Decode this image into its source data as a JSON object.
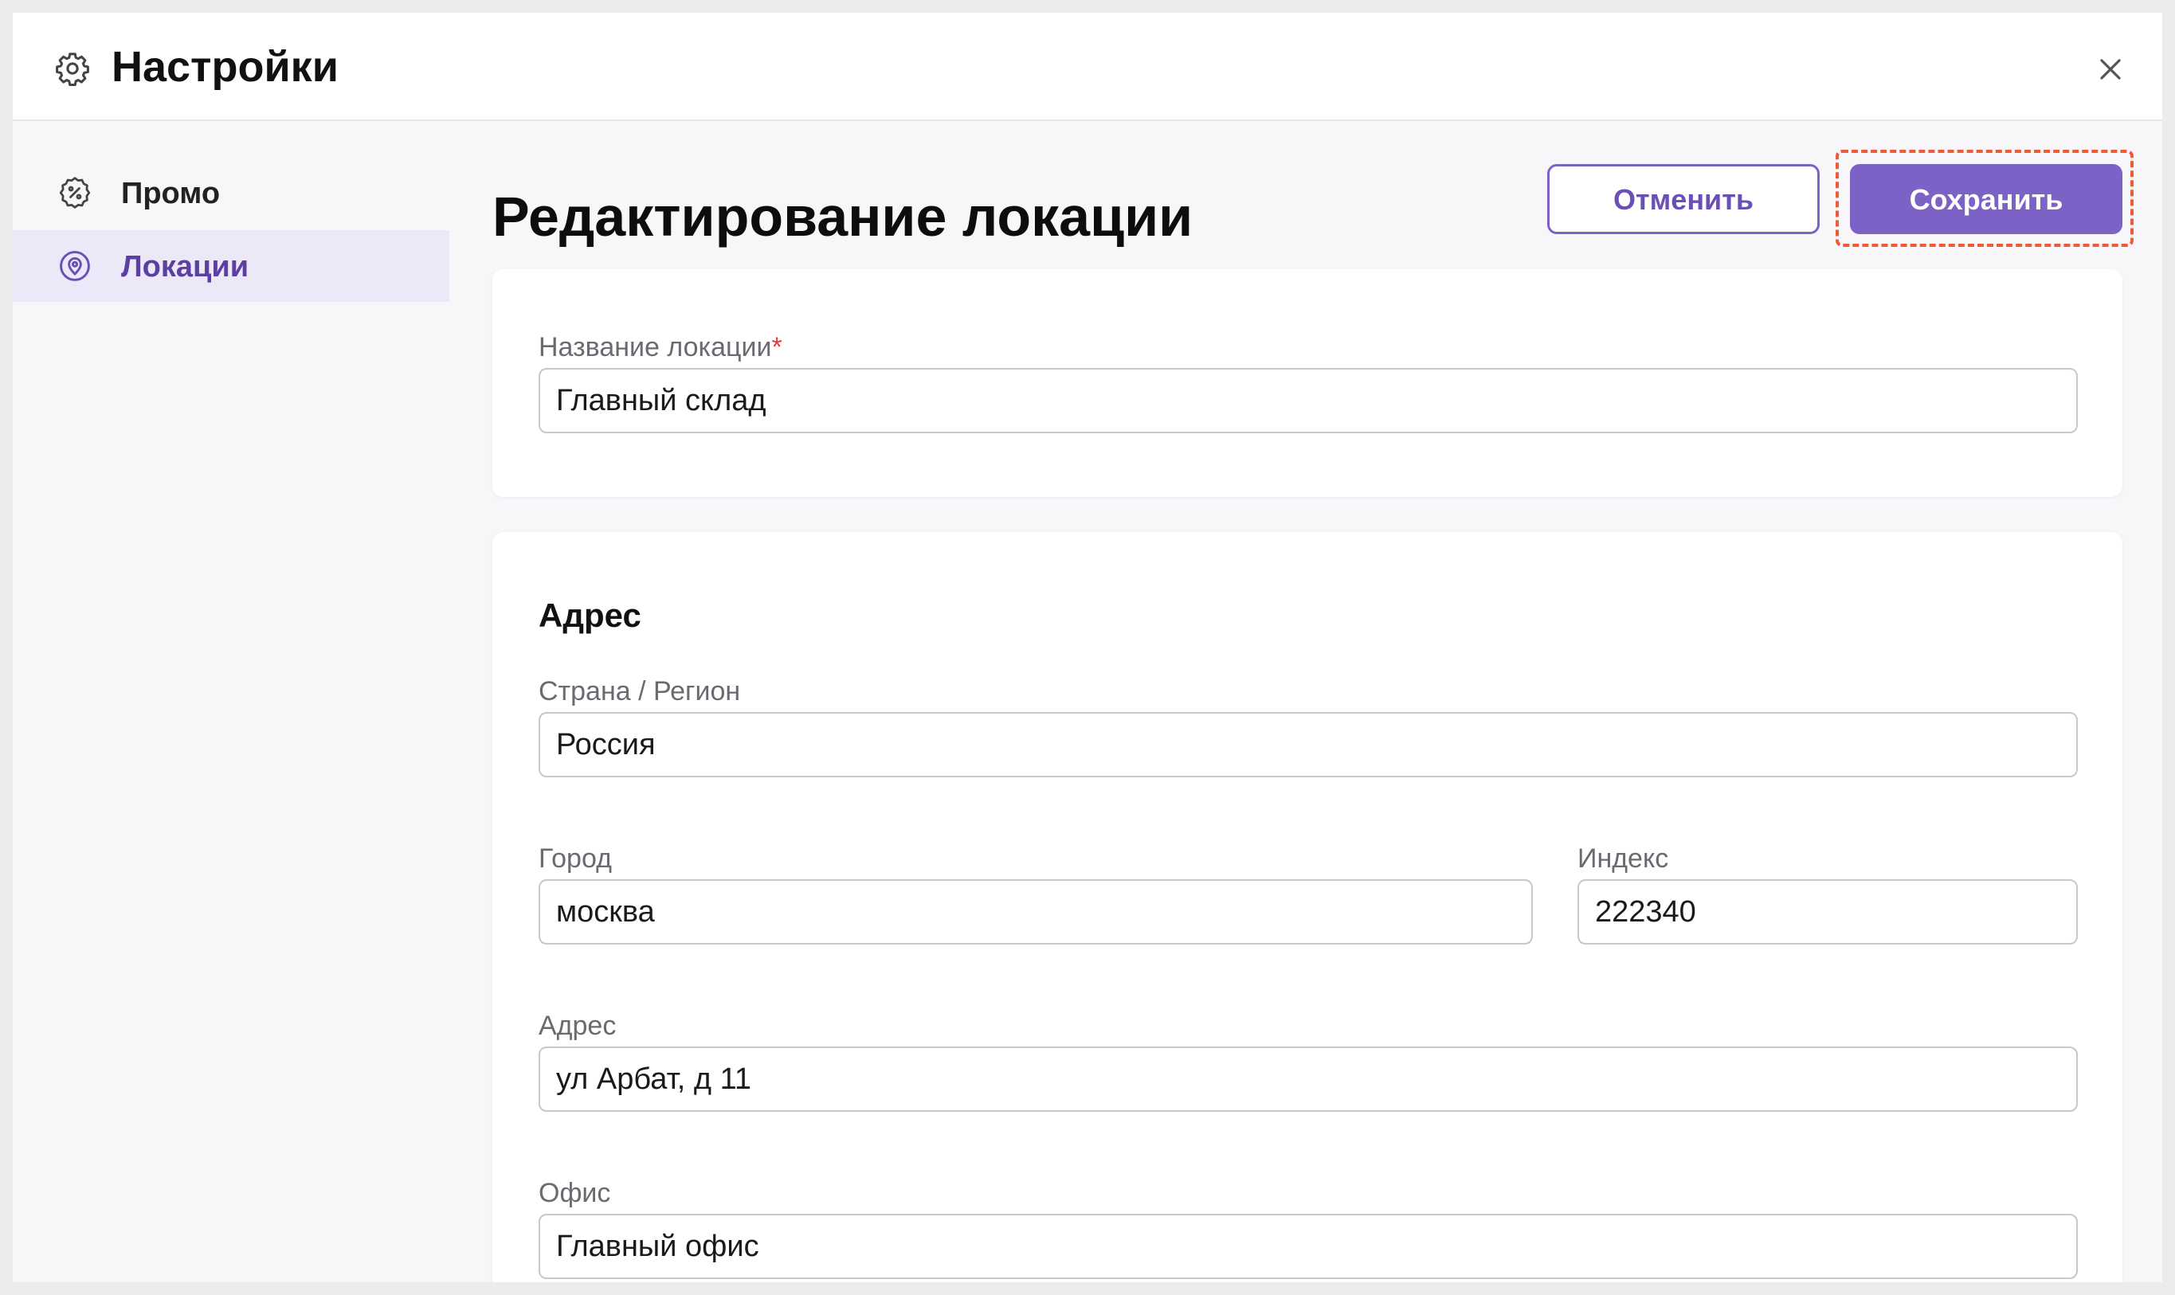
{
  "header": {
    "title": "Настройки",
    "gear_icon": "gear-icon",
    "close_icon": "close-icon"
  },
  "sidebar": {
    "items": [
      {
        "label": "Промо",
        "icon": "percent-badge-icon",
        "active": false
      },
      {
        "label": "Локации",
        "icon": "location-pin-icon",
        "active": true
      }
    ]
  },
  "main": {
    "title": "Редактирование локации",
    "cancel_label": "Отменить",
    "save_label": "Сохранить"
  },
  "location_name": {
    "label": "Название локации",
    "required_mark": "*",
    "value": "Главный склад"
  },
  "address_section": {
    "title": "Адрес",
    "country": {
      "label": "Страна / Регион",
      "value": "Россия"
    },
    "city": {
      "label": "Город",
      "value": "москва"
    },
    "postal": {
      "label": "Индекс",
      "value": "222340"
    },
    "address": {
      "label": "Адрес",
      "value": "ул Арбат, д 11"
    },
    "office": {
      "label": "Офис",
      "value": "Главный офис"
    }
  },
  "colors": {
    "accent": "#7c62c7",
    "active_bg": "#ebe8f7",
    "highlight": "#f05a36",
    "required": "#e23b3b"
  }
}
